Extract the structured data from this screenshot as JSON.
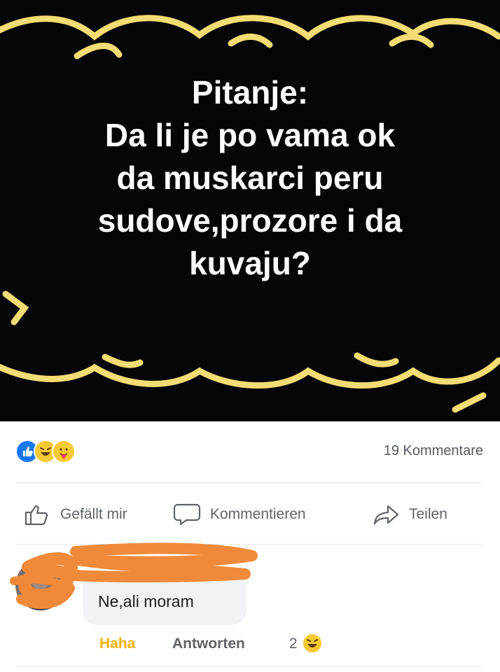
{
  "post": {
    "question_lines": [
      "Pitanje:",
      "Da li je po vama ok",
      "da muskarci peru",
      "sudove,prozore i da",
      "kuvaju?"
    ]
  },
  "reactions": {
    "icons": [
      "like-icon",
      "haha-icon",
      "care-icon"
    ],
    "comments_count": "19 Kommentare"
  },
  "actions": {
    "like": "Gefällt mir",
    "comment": "Kommentieren",
    "share": "Teilen"
  },
  "comment": {
    "text": "Ne,ali moram",
    "haha": "Haha",
    "reply": "Antworten",
    "reaction_count": "2"
  },
  "colors": {
    "post_background": "#050505",
    "frame_yellow": "#f4dc74",
    "facebook_blue": "#1877f2",
    "haha_yellow": "#f0b100",
    "scribble_orange": "#f08a3a"
  }
}
